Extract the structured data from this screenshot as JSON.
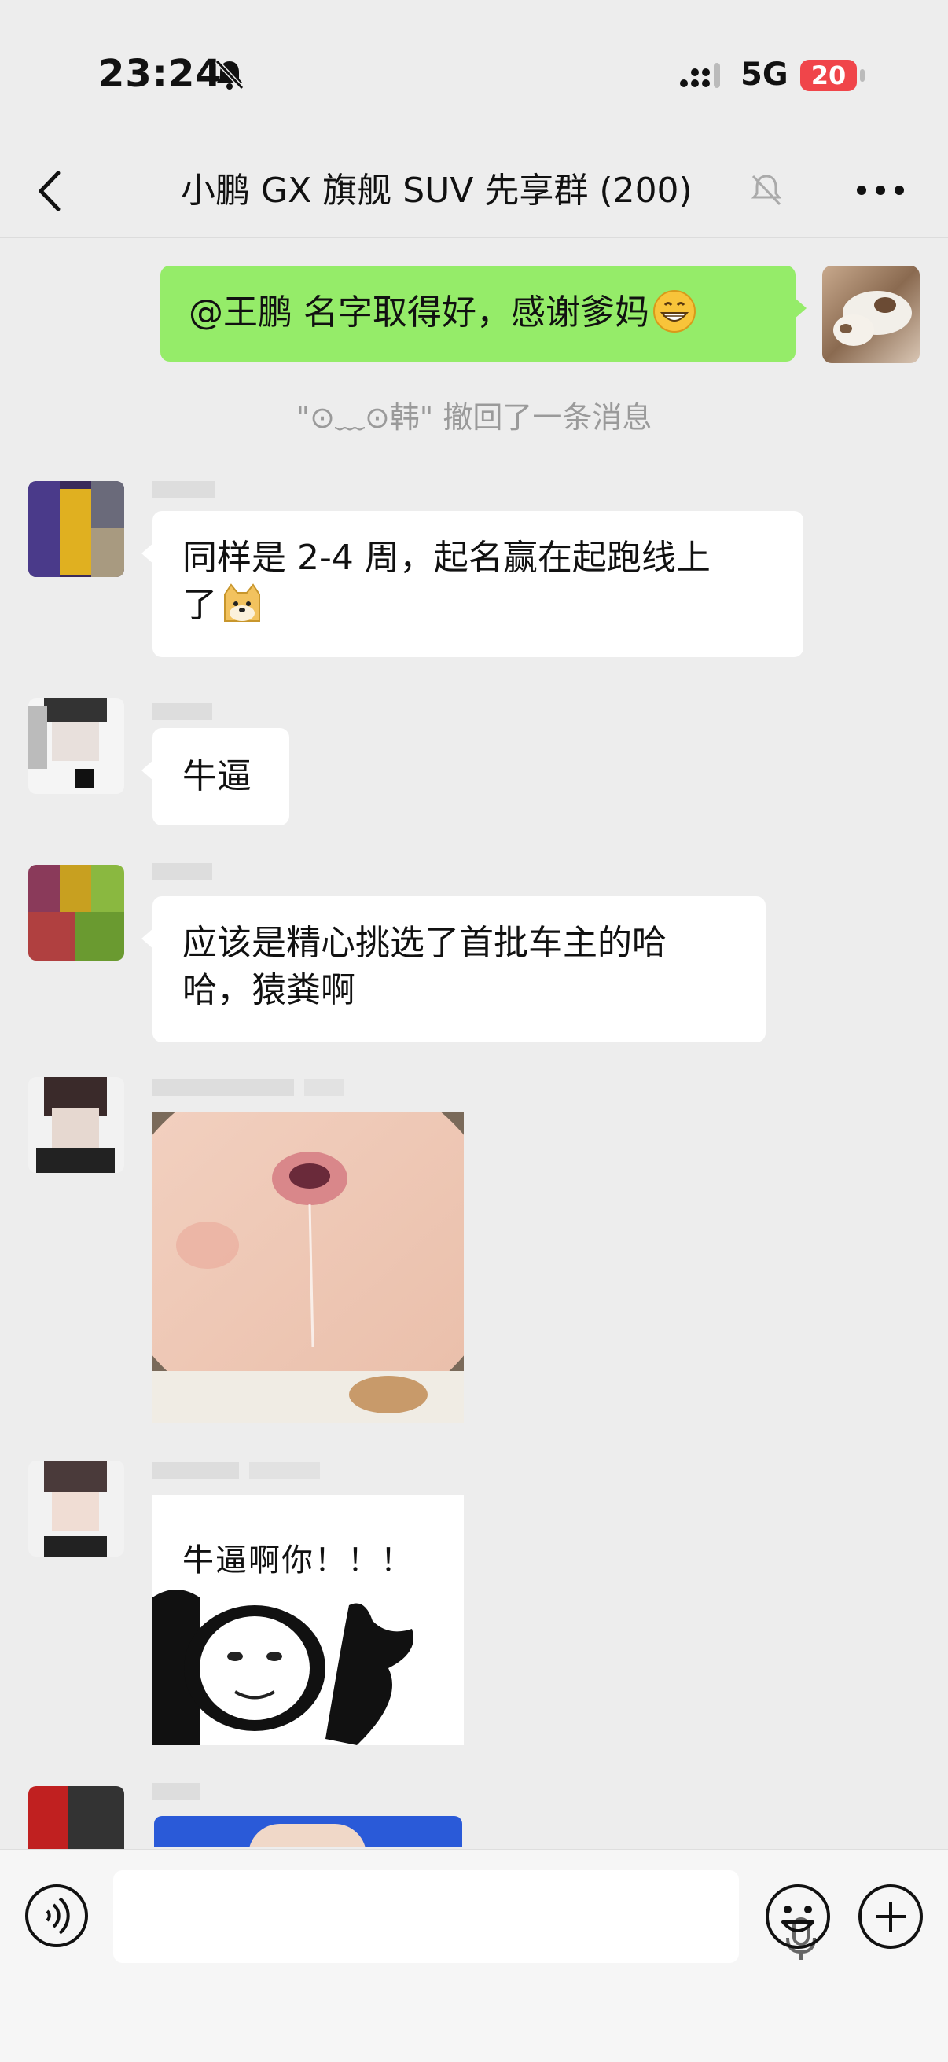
{
  "status_bar": {
    "time": "23:24",
    "network": "5G",
    "battery": "20",
    "icons": [
      "bell-off-icon",
      "signal-icon",
      "battery-icon"
    ]
  },
  "header": {
    "title": "小鹏 GX 旗舰 SUV 先享群 (200)",
    "icons": [
      "back-icon",
      "mute-bell-icon",
      "more-icon"
    ]
  },
  "messages": {
    "self_text": "@王鹏 名字取得好，感谢爹妈",
    "recall_notice": "\"⊙﹏⊙韩\" 撤回了一条消息",
    "msg2_line1": "同样是 2-4 周，起名赢在起跑线上",
    "msg2_line2": "了",
    "msg3_text": "牛逼",
    "msg4_line1": "应该是精心挑选了首批车主的哈",
    "msg4_line2": "哈，猿粪啊",
    "panda_caption": "牛逼啊你！！！"
  },
  "input_bar": {
    "icons": [
      "voice-icon",
      "microphone-icon",
      "emoji-icon",
      "plus-icon"
    ]
  },
  "colors": {
    "background": "#ededed",
    "self_bubble": "#95ec69",
    "other_bubble": "#ffffff",
    "battery_low": "#f0454a"
  }
}
